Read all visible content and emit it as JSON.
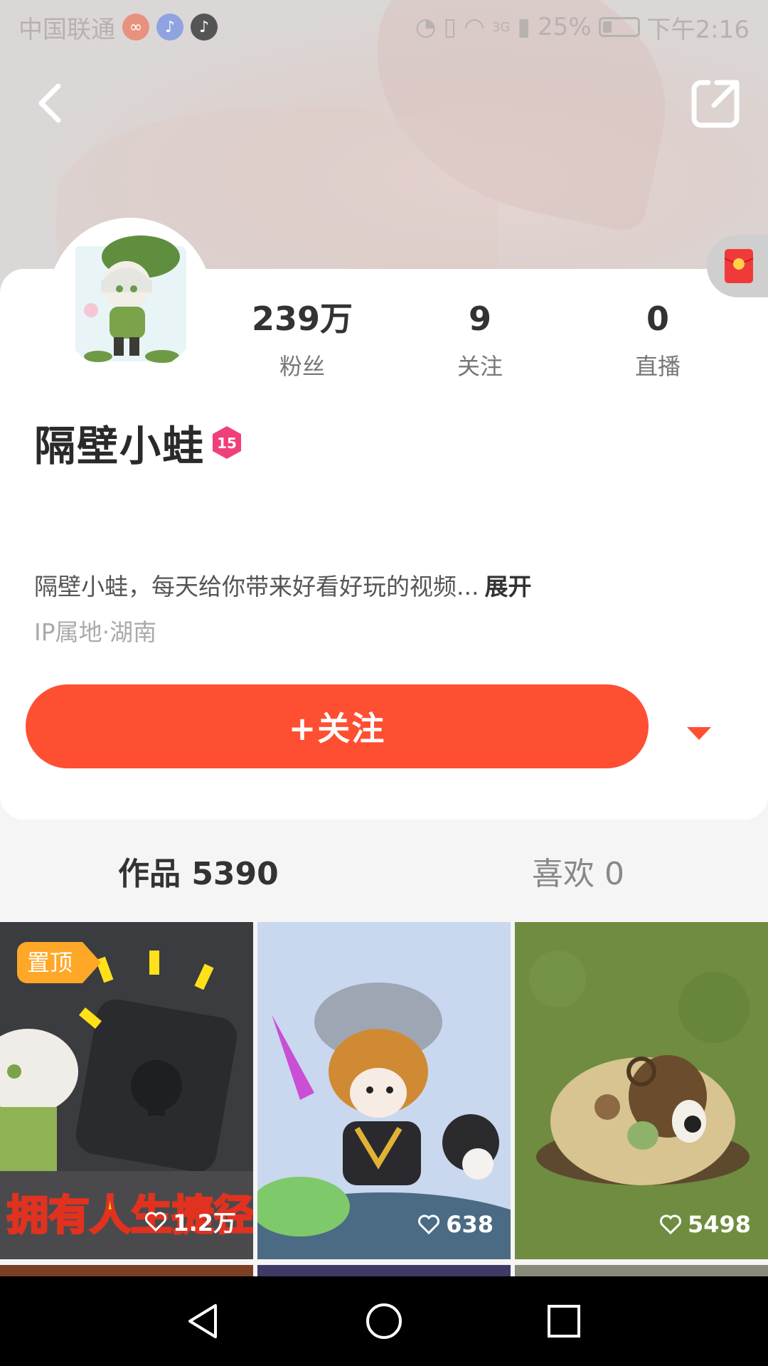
{
  "status_bar": {
    "carrier": "中国联通",
    "network": "3G",
    "battery_percent": "25%",
    "time": "下午2:16"
  },
  "profile": {
    "name": "隔壁小蛙",
    "level": "15",
    "bio": "隔壁小蛙，每天给你带来好看好玩的视频...",
    "bio_expand": "展开",
    "ip_location": "IP属地·湖南",
    "stats": [
      {
        "value": "239万",
        "label": "粉丝"
      },
      {
        "value": "9",
        "label": "关注"
      },
      {
        "value": "0",
        "label": "直播"
      }
    ]
  },
  "actions": {
    "follow_label": "+关注"
  },
  "tabs": [
    {
      "label": "作品 5390",
      "active": true
    },
    {
      "label": "喜欢 0",
      "active": false
    }
  ],
  "videos": [
    {
      "pinned": true,
      "pin_label": "置顶",
      "overlay_text": "拥有人生捷径",
      "likes": "1.2万"
    },
    {
      "pinned": false,
      "likes": "638"
    },
    {
      "pinned": false,
      "likes": "5498"
    }
  ],
  "colors": {
    "accent": "#fe4f33",
    "pin": "#ffa727",
    "level_badge": "#f0407a"
  }
}
